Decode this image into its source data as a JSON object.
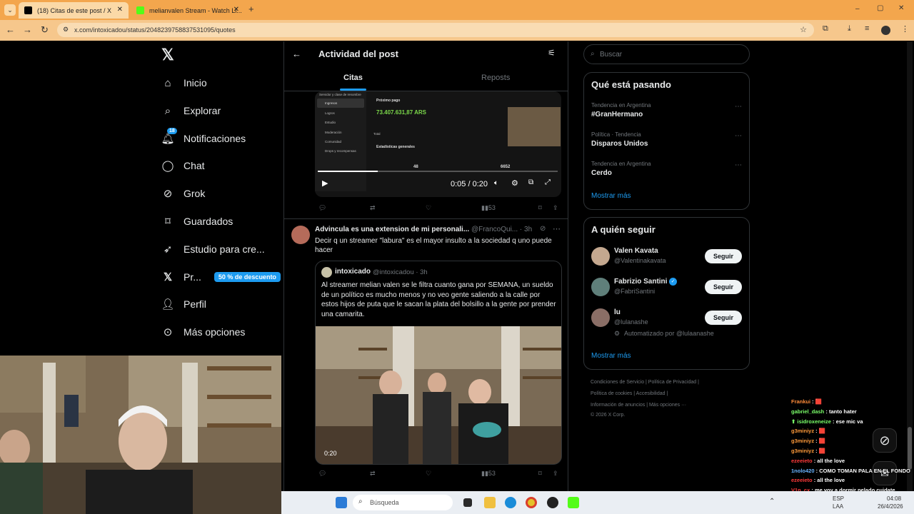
{
  "browser": {
    "tabs": [
      {
        "title": "(18) Citas de este post / X",
        "active": true
      },
      {
        "title": "melianvalen Stream - Watch Li...",
        "active": false
      }
    ],
    "new_tab": "+",
    "url": "x.com/intoxicadou/status/2048239758837531095/quotes",
    "window_controls": [
      "–",
      "▢",
      "✕"
    ]
  },
  "sidebar": {
    "logo": "𝕏",
    "items": [
      {
        "icon": "home-icon",
        "label": "Inicio",
        "badge": ""
      },
      {
        "icon": "search-icon",
        "label": "Explorar",
        "badge": ""
      },
      {
        "icon": "bell-icon",
        "label": "Notificaciones",
        "badge": "18"
      },
      {
        "icon": "chat-icon",
        "label": "Chat",
        "badge": ""
      },
      {
        "icon": "grok-icon",
        "label": "Grok",
        "badge": ""
      },
      {
        "icon": "bookmark-icon",
        "label": "Guardados",
        "badge": ""
      },
      {
        "icon": "rocket-icon",
        "label": "Estudio para cre...",
        "badge": ""
      },
      {
        "icon": "x-premium-icon",
        "label": "Pr...",
        "badge": "",
        "promo": "50 % de descuento"
      },
      {
        "icon": "person-icon",
        "label": "Perfil",
        "badge": ""
      },
      {
        "icon": "more-circle-icon",
        "label": "Más opciones",
        "badge": ""
      }
    ]
  },
  "main": {
    "header": {
      "title": "Actividad del post",
      "tabs": [
        "Citas",
        "Reposts"
      ],
      "selected_tab": "Citas"
    },
    "post1": {
      "video": {
        "menu_items": [
          "Ingresos",
          "Logros",
          "Estudio",
          "Moderación",
          "Comunidad",
          "Drops y recompensas"
        ],
        "menu_header": "Servidor y clase de renombre",
        "next_payment_label": "Próximo pago",
        "amount": "73.407.631,87 ARS",
        "total_label": "Total",
        "stats_label": "Estadísticas generales",
        "stat1_value": "48",
        "stat2_value": "6652",
        "time": "0:05 / 0:20"
      },
      "actions": {
        "views": "53"
      }
    },
    "post2": {
      "author": "Advincula es una extension de mi personali...",
      "handle": "@FrancoQui...",
      "time": "· 3h",
      "text": "Decir q un streamer \"labura\" es el mayor insulto a la sociedad q uno puede hacer",
      "quote": {
        "author": "intoxicado",
        "handle": "@intoxicadou · 3h",
        "text": "Al streamer melian valen se le filtra cuanto gana por SEMANA, un sueldo de un político es mucho menos y no veo gente saliendo a la calle por estos hijos de puta que le sacan la plata del bolsillo a la gente por prender una camarita.",
        "video_time": "0:20"
      },
      "actions": {
        "views": "53"
      }
    }
  },
  "right": {
    "search_placeholder": "Buscar",
    "trends_title": "Qué está pasando",
    "trends": [
      {
        "meta": "Tendencia en Argentina",
        "name": "#GranHermano"
      },
      {
        "meta": "Política · Tendencia",
        "name": "Disparos Unidos"
      },
      {
        "meta": "Tendencia en Argentina",
        "name": "Cerdo"
      }
    ],
    "trends_more": "Mostrar más",
    "follow_title": "A quién seguir",
    "follow": [
      {
        "name": "Valen Kavata",
        "handle": "@Valentinakavata",
        "button": "Seguir",
        "extra": ""
      },
      {
        "name": "Fabrizio Santini",
        "handle": "@FabriSantini",
        "button": "Seguir",
        "extra": ""
      },
      {
        "name": "lu",
        "handle": "@lulanashe",
        "button": "Seguir",
        "extra": "Automatizado por @lulaanashe"
      }
    ],
    "follow_more": "Mostrar más",
    "footer": [
      "Condiciones de Servicio  |  Política de Privacidad  |",
      "Política de cookies  |  Accesibilidad  |",
      "Información de anuncios  |  Más opciones ···",
      "© 2026 X Corp."
    ]
  },
  "chat": [
    {
      "user": "Frankui",
      "color": "#ff8c3a",
      "msg": "🟥"
    },
    {
      "user": "gabriel_dash",
      "color": "#7bff6a",
      "msg": "tanto hater"
    },
    {
      "user": "⬆ isidroxeneize",
      "color": "#7bff6a",
      "msg": "ese mic va"
    },
    {
      "user": "g3miniyz",
      "color": "#ff9a3a",
      "msg": "🟥"
    },
    {
      "user": "g3miniyz",
      "color": "#ff9a3a",
      "msg": "🟥"
    },
    {
      "user": "g3miniyz",
      "color": "#ff9a3a",
      "msg": "🟥"
    },
    {
      "user": "ezeeieto",
      "color": "#ff3a3a",
      "msg": "all the love"
    },
    {
      "user": "1nolo420",
      "color": "#6ab4ff",
      "msg": "COMO TOMAN PALA EN EL FONDO"
    },
    {
      "user": "ezeeieto",
      "color": "#ff3a3a",
      "msg": "all the love"
    },
    {
      "user": "V1n_cx",
      "color": "#ff3a3a",
      "msg": "me voy a dormir pelado cuidate"
    }
  ],
  "taskbar": {
    "search": "Búsqueda",
    "lang": "ESP",
    "lang2": "LAA",
    "time": "04:08",
    "date": "26/4/2026"
  }
}
